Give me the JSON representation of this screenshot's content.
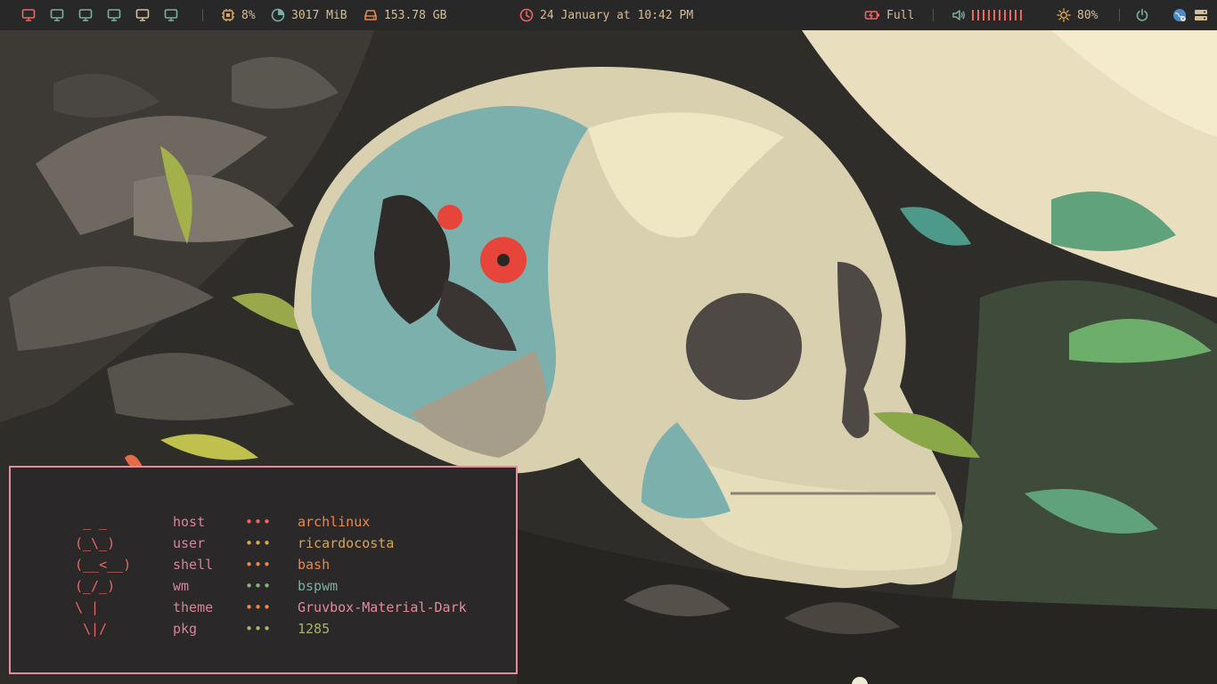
{
  "topbar": {
    "workspaces": [
      {
        "icon": "monitor-icon",
        "color": "#ea6962"
      },
      {
        "icon": "monitor-icon",
        "color": "#7daea3"
      },
      {
        "icon": "monitor-icon",
        "color": "#7daea3"
      },
      {
        "icon": "monitor-icon",
        "color": "#7daea3"
      },
      {
        "icon": "monitor-icon",
        "color": "#d4be98"
      },
      {
        "icon": "monitor-icon",
        "color": "#7daea3"
      }
    ],
    "cpu": {
      "icon": "cpu-icon",
      "value": "8%",
      "color": "#d8a657"
    },
    "memory": {
      "icon": "memory-pie-icon",
      "value": "3017 MiB",
      "color": "#7daea3"
    },
    "disk": {
      "icon": "hard-drive-icon",
      "value": "153.78 GB",
      "color": "#e78a4e"
    },
    "clock": {
      "icon": "clock-icon",
      "value": "24 January at 10:42 PM",
      "color": "#ea6962"
    },
    "battery": {
      "icon": "battery-charging-icon",
      "value": "Full",
      "color": "#ea6962"
    },
    "volume": {
      "icon": "speaker-icon",
      "level_bars": 10,
      "color": "#ea6962",
      "accent": "#7daea3"
    },
    "brightness": {
      "icon": "sun-icon",
      "value": "80%",
      "color": "#d8a657"
    },
    "power": {
      "icon": "power-icon",
      "color": "#7daea3"
    },
    "tray": {
      "icons": [
        "network-globe-icon",
        "server-icon"
      ]
    }
  },
  "terminal": {
    "border_color": "#e78a9e",
    "ascii_art": " _ _\n(_\\_)\n(__<__)\n(_/_)\n\\ |\n \\|/",
    "rows": [
      {
        "key": "host",
        "value": "archlinux",
        "dots": "•••",
        "dot_color": "#ea6962",
        "value_color": "#e78a4e"
      },
      {
        "key": "user",
        "value": "ricardocosta",
        "dots": "•••",
        "dot_color": "#d8a657",
        "value_color": "#d8a657"
      },
      {
        "key": "shell",
        "value": "bash",
        "dots": "•••",
        "dot_color": "#e78a4e",
        "value_color": "#e78a4e"
      },
      {
        "key": "wm",
        "value": "bspwm",
        "dots": "•••",
        "dot_color": "#89b482",
        "value_color": "#7daea3"
      },
      {
        "key": "theme",
        "value": "Gruvbox-Material-Dark",
        "dots": "•••",
        "dot_color": "#e78a4e",
        "value_color": "#e78a9e"
      },
      {
        "key": "pkg",
        "value": "1285",
        "dots": "•••",
        "dot_color": "#a9b665",
        "value_color": "#a9b665"
      }
    ]
  }
}
